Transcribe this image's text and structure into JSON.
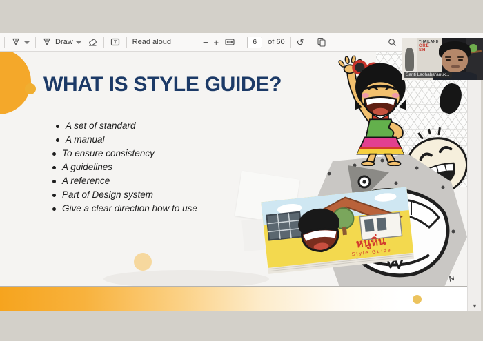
{
  "app": {
    "window_background": "#d3d0c9"
  },
  "toolbar": {
    "draw_label": "Draw",
    "read_aloud_label": "Read aloud",
    "page_current": "6",
    "page_total_label": "of 60",
    "icons": {
      "minus": "−",
      "plus": "+",
      "rotate": "↺",
      "scroll_down": "▾"
    }
  },
  "webcam": {
    "name_label": "Santi Laohabaranuk...",
    "poster": {
      "line1": "THAILAND",
      "line2": "CRE",
      "line3": "SH"
    }
  },
  "slide": {
    "title": "WHAT IS STYLE GUIDE?",
    "bullets": [
      "A set of standard",
      "A manual",
      "To ensure consistency",
      "A guidelines",
      "A reference",
      "Part of Design system",
      "Give a clear direction how to use"
    ],
    "colors": {
      "title": "#1C3A67",
      "accent_orange": "#F2A92C",
      "gradient_bar": "#F6A41E"
    }
  },
  "book": {
    "title": "หนูหิ่น",
    "subtitle": "Style Guide"
  }
}
